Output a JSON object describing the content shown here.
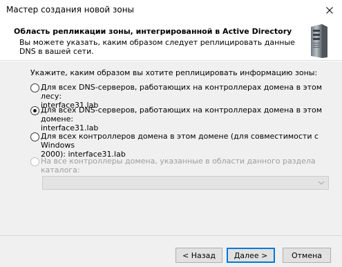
{
  "window": {
    "title": "Мастер создания новой зоны",
    "close_icon": "close-icon"
  },
  "header": {
    "title": "Область репликации зоны, интегрированной в Active Directory",
    "description": "Вы можете указать, каким образом следует реплицировать данные DNS в вашей сети.",
    "icon": "server-icon"
  },
  "main": {
    "prompt": "Укажите, каким образом вы хотите реплицировать информацию зоны:",
    "options": [
      {
        "line1": "Для всех DNS-серверов, работающих на контроллерах домена в этом лесу:",
        "line2": "interface31.lab",
        "selected": false,
        "enabled": true
      },
      {
        "line1": "Для всех DNS-серверов, работающих на контроллерах домена в этом домене:",
        "line2": "interface31.lab",
        "selected": true,
        "enabled": true
      },
      {
        "line1": "Для всех контроллеров домена в этом домене (для совместимости с Windows",
        "line2": "2000): interface31.lab",
        "selected": false,
        "enabled": true
      },
      {
        "line1": "На все контроллеры домена, указанные в области данного раздела каталога:",
        "line2": "",
        "selected": false,
        "enabled": false
      }
    ],
    "partition_select": {
      "value": "",
      "enabled": false
    }
  },
  "footer": {
    "back_label": "< Назад",
    "next_label": "Далее >",
    "cancel_label": "Отмена"
  },
  "colors": {
    "dialog_bg": "#f0f0f0",
    "header_bg": "#ffffff",
    "focus_border": "#0078d7",
    "button_bg": "#e1e1e1",
    "disabled_text": "#9c9c9c"
  }
}
